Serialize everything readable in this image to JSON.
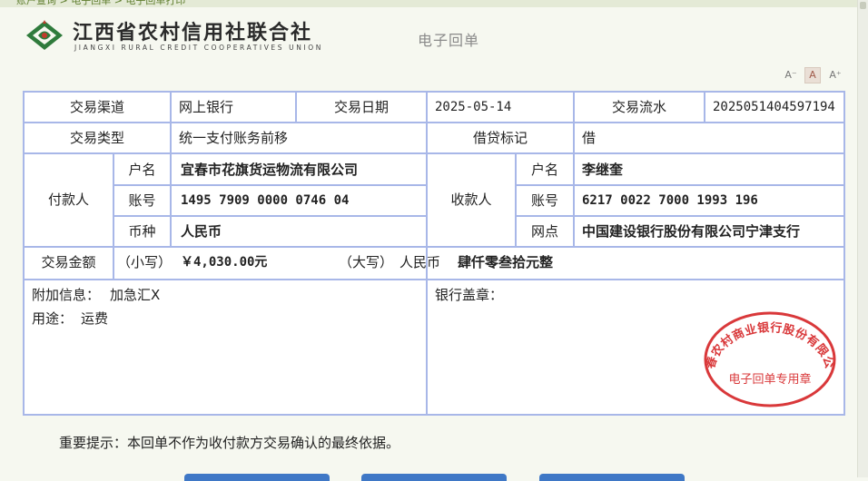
{
  "breadcrumb": "账户查询 > 电子回单 > 电子回单打印",
  "bank": {
    "name_cn": "江西省农村信用社联合社",
    "name_en": "JIANGXI RURAL CREDIT COOPERATIVES UNION"
  },
  "doc_title": "电子回单",
  "font_controls": [
    "A⁻",
    "A",
    "A⁺"
  ],
  "receipt": {
    "channel_label": "交易渠道",
    "channel": "网上银行",
    "date_label": "交易日期",
    "date": "2025-05-14",
    "serial_label": "交易流水",
    "serial": "2025051404597194",
    "type_label": "交易类型",
    "type": "统一支付账务前移",
    "dc_label": "借贷标记",
    "dc": "借",
    "payer_label": "付款人",
    "payer": {
      "name_label": "户名",
      "name": "宜春市花旗货运物流有限公司",
      "account_label": "账号",
      "account": "1495 7909 0000 0746 04",
      "currency_label": "币种",
      "currency": "人民币"
    },
    "payee_label": "收款人",
    "payee": {
      "name_label": "户名",
      "name": "李继奎",
      "account_label": "账号",
      "account": "6217 0022 7000 1993 196",
      "branch_label": "网点",
      "branch": "中国建设银行股份有限公司宁津支行"
    },
    "amount_label": "交易金额",
    "amount_small_label": "（小写）",
    "amount_small": "￥4,030.00元",
    "amount_big_label": "（大写）",
    "amount_big_currency": "人民币",
    "amount_big": "肆仟零叁拾元整",
    "extra_label": "附加信息：",
    "extra": "加急汇X",
    "purpose_label": "用途：",
    "purpose": "运费",
    "seal_label": "银行盖章："
  },
  "stamp": {
    "arc_text": "宜春农村商业银行股份有限公司",
    "center_text": "电子回单专用章",
    "color": "#d9383a"
  },
  "notice": "重要提示：本回单不作为收付款方交易确认的最终依据。"
}
